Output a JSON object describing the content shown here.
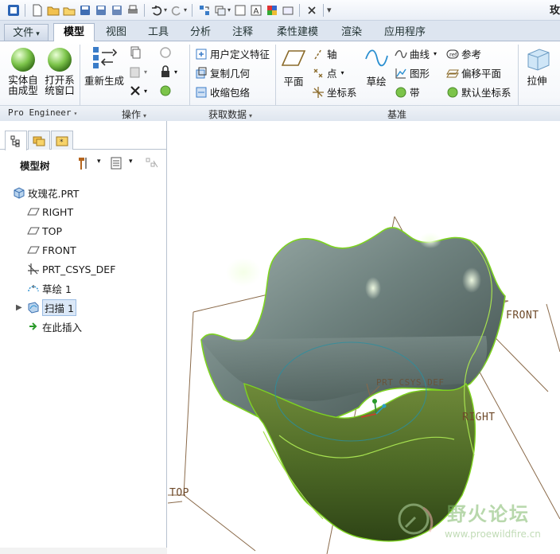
{
  "app": {
    "title_fragment": "玫"
  },
  "colors": {
    "accent": "#2b64b5",
    "surface": "#6f8380",
    "surface_edge": "#7ed321",
    "plane": "#8a6a4a",
    "axis_csys": "#2aa0c0",
    "inner_curve": "#2a8fa0"
  },
  "tabs": [
    {
      "label": "文件",
      "dropdown": "▾"
    },
    {
      "label": "模型"
    },
    {
      "label": "视图"
    },
    {
      "label": "工具"
    },
    {
      "label": "分析"
    },
    {
      "label": "注释"
    },
    {
      "label": "柔性建模"
    },
    {
      "label": "渲染"
    },
    {
      "label": "应用程序"
    }
  ],
  "ribbon": {
    "pro_engineer": {
      "btn1_line1": "实体自",
      "btn1_line2": "由成型",
      "btn2_line1": "打开系",
      "btn2_line2": "统窗口",
      "label": "Pro Engineer"
    },
    "operations": {
      "regenerate": "重新生成",
      "label": "操作"
    },
    "get_data": {
      "user_feature": "用户定义特征",
      "copy_geometry": "复制几何",
      "shrinkwrap": "收缩包络",
      "label": "获取数据"
    },
    "datum": {
      "plane": "平面",
      "axis": "轴",
      "point": "点",
      "csys": "坐标系",
      "sketch": "草绘",
      "curve": "曲线",
      "graph": "图形",
      "ribbon": "带",
      "reference": "参考",
      "offset_plane": "偏移平面",
      "default_csys": "默认坐标系",
      "label": "基准"
    },
    "shapes": {
      "extrude": "拉伸"
    }
  },
  "model_tree": {
    "title": "模型树",
    "items": [
      {
        "label": "玫瑰花.PRT",
        "icon": "part-icon"
      },
      {
        "label": "RIGHT",
        "icon": "datum-plane-icon"
      },
      {
        "label": "TOP",
        "icon": "datum-plane-icon"
      },
      {
        "label": "FRONT",
        "icon": "datum-plane-icon"
      },
      {
        "label": "PRT_CSYS_DEF",
        "icon": "csys-icon"
      },
      {
        "label": "草绘 1",
        "icon": "sketch-icon"
      },
      {
        "label": "扫描 1",
        "icon": "sweep-icon"
      },
      {
        "label": "在此插入",
        "icon": "insert-here-icon"
      }
    ]
  },
  "graphics": {
    "plane_labels": {
      "front": "FRONT",
      "right": "RIGHT",
      "top": "TOP"
    },
    "csys_label": "PRT_CSYS_DEF"
  },
  "watermark": {
    "title": "野火论坛",
    "url": "www.proewildfire.cn"
  }
}
